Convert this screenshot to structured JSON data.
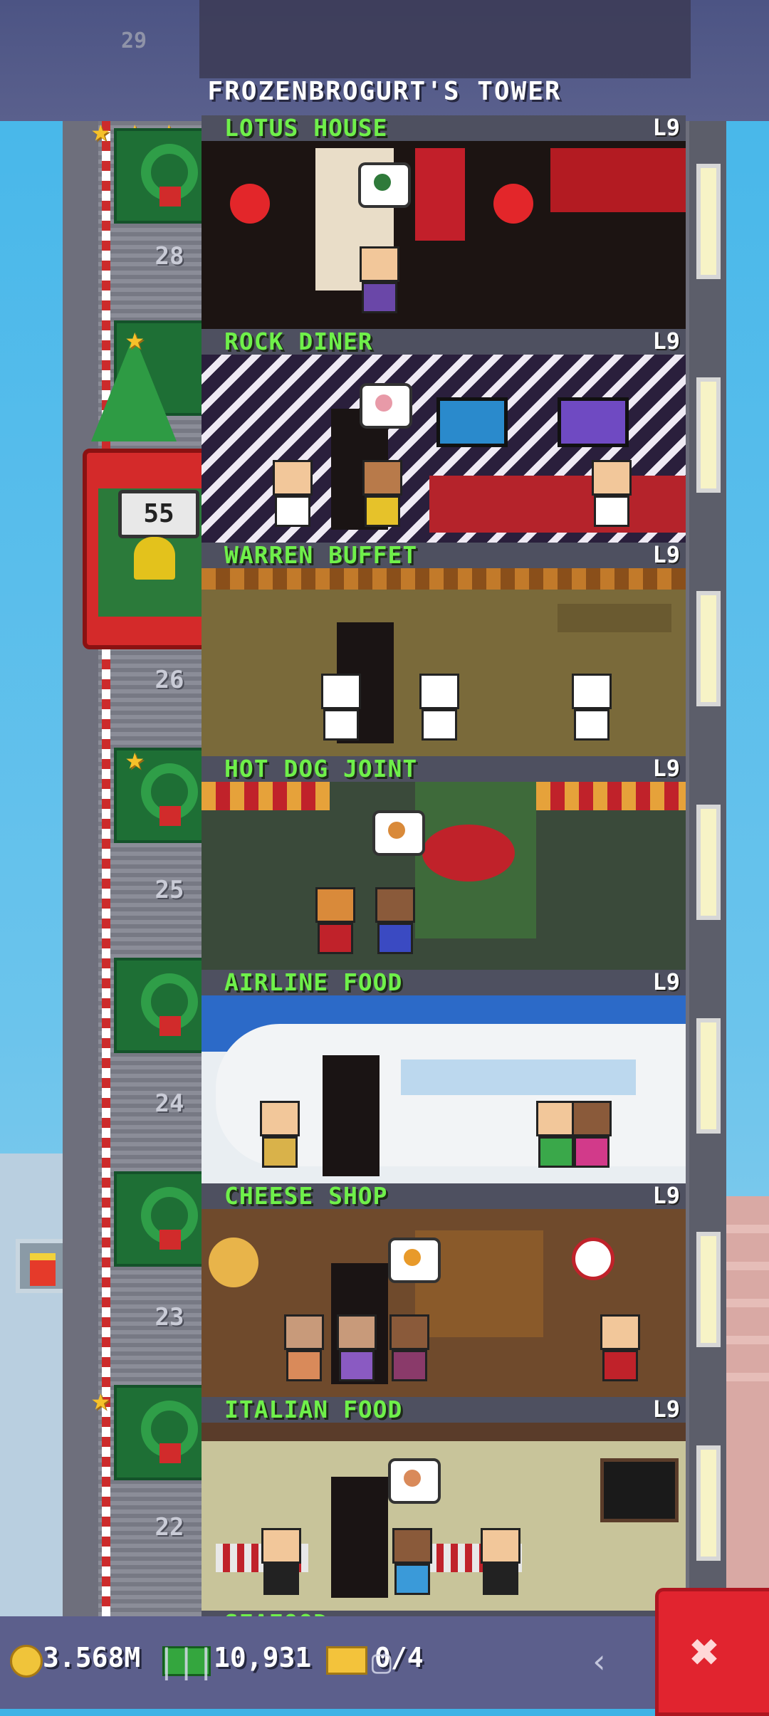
{
  "tower": {
    "title": "FROZENBROGURT'S TOWER",
    "top_floor_number": "29",
    "elevator_count": "55"
  },
  "shaft_numbers": {
    "n28": "28",
    "n26": "26",
    "n25": "25",
    "n24": "24",
    "n23": "23",
    "n22": "22"
  },
  "floors": [
    {
      "name": "LOTUS HOUSE",
      "level": "L9",
      "bg": "#1c1412",
      "accent": "#c21f2a"
    },
    {
      "name": "ROCK DINER",
      "level": "L9",
      "bg": "#2a1f3c",
      "accent": "#e6e6ef"
    },
    {
      "name": "WARREN BUFFET",
      "level": "L9",
      "bg": "#7a6a3a",
      "accent": "#d7a04a"
    },
    {
      "name": "HOT DOG JOINT",
      "level": "L9",
      "bg": "#3a4a3a",
      "accent": "#e6a23a"
    },
    {
      "name": "AIRLINE FOOD",
      "level": "L9",
      "bg": "#e9eef2",
      "accent": "#2c6ac8"
    },
    {
      "name": "CHEESE SHOP",
      "level": "L9",
      "bg": "#6f4a2c",
      "accent": "#e8b44a"
    },
    {
      "name": "ITALIAN FOOD",
      "level": "L9",
      "bg": "#c8c49a",
      "accent": "#5a3c2a"
    }
  ],
  "next_floor_name": "SEAFOOD",
  "hud": {
    "coins": "3.568M",
    "bux": "10,931",
    "tickets": "0/4"
  },
  "icons": {
    "coin": "coin-icon",
    "bux": "bux-icon",
    "ticket": "ticket-icon",
    "build": "wrench-icon"
  },
  "colors": {
    "floor_name": "#6ff04a",
    "hud_bg": "#5c5f8c",
    "build_button": "#e1242f"
  }
}
